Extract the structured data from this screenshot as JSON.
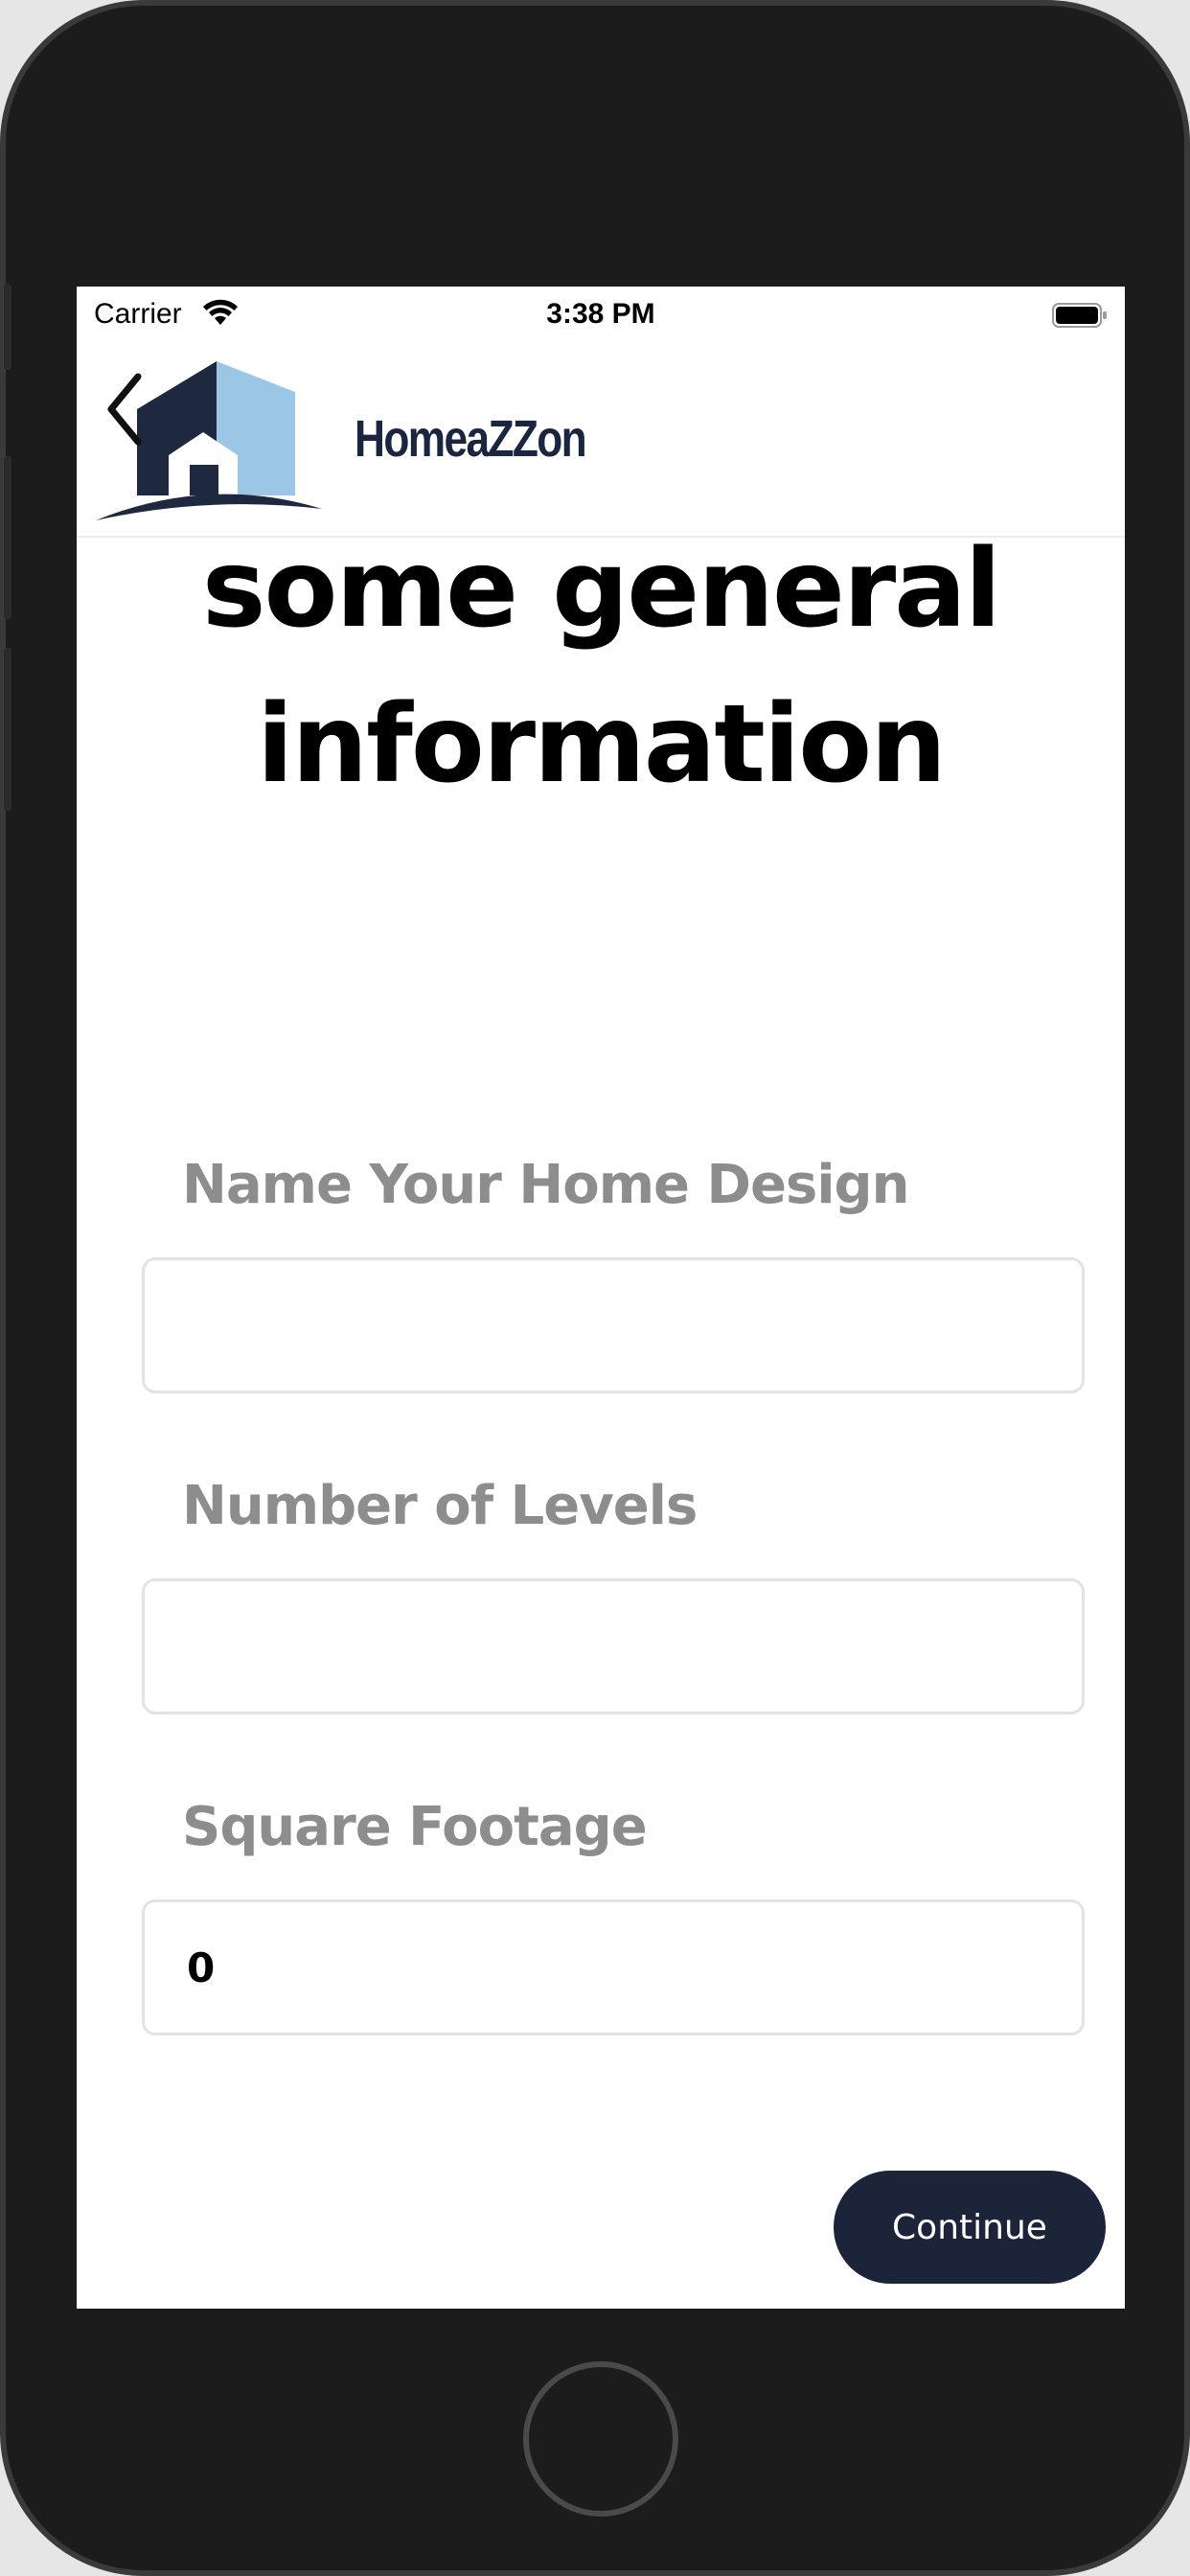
{
  "status_bar": {
    "carrier": "Carrier",
    "time": "3:38 PM"
  },
  "nav": {
    "brand": "HomeaZZon",
    "back_icon": "chevron-left-icon",
    "logo_icon": "house-logo-icon"
  },
  "page": {
    "title": "some general information"
  },
  "form": {
    "fields": [
      {
        "label": "Name Your Home Design",
        "value": ""
      },
      {
        "label": "Number of Levels",
        "value": ""
      },
      {
        "label": "Square Footage",
        "value": "0"
      }
    ]
  },
  "actions": {
    "continue_label": "Continue"
  },
  "colors": {
    "brand_dark": "#1b2438",
    "logo_light_blue": "#9cc6e6",
    "label_gray": "#8d8d8d"
  }
}
